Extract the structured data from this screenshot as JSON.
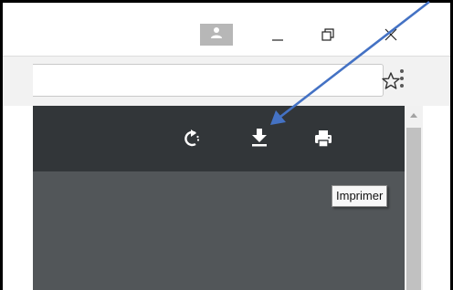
{
  "window": {
    "controls": [
      "profile-icon",
      "minimize-icon",
      "restore-icon",
      "close-icon"
    ]
  },
  "addressbar": {
    "value": "",
    "icons": [
      "bookmark-star-icon",
      "more-vert-icon"
    ]
  },
  "pdf_toolbar": {
    "icons": [
      "rotate-icon",
      "download-icon",
      "print-icon"
    ]
  },
  "tooltip": {
    "text": "Imprimer"
  },
  "annotation": {
    "arrow_color": "#4472c4",
    "points_to": "download-icon"
  },
  "colors": {
    "toolbar_bg": "#323639",
    "viewer_bg": "#525659",
    "icon_color": "#ffffff"
  }
}
